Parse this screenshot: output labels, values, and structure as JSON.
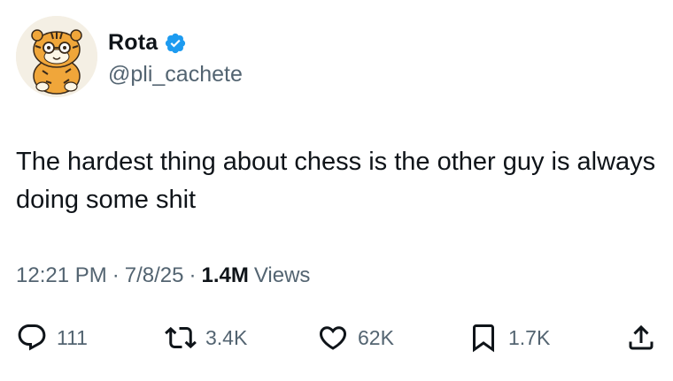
{
  "author": {
    "name": "Rota",
    "handle": "@pli_cachete",
    "verified": true,
    "avatar": "cartoon-tiger-avatar",
    "verified_icon": "verified-badge-icon",
    "verified_color": "#1d9bf0"
  },
  "tweet": {
    "text": "The hardest thing about chess is the other guy is always doing some shit"
  },
  "meta": {
    "time": "12:21 PM",
    "separator": "·",
    "date": "7/8/25",
    "views_count": "1.4M",
    "views_label": "Views"
  },
  "actions": {
    "replies": {
      "icon": "reply-icon",
      "count": "111"
    },
    "reposts": {
      "icon": "repost-icon",
      "count": "3.4K"
    },
    "likes": {
      "icon": "heart-icon",
      "count": "62K"
    },
    "bookmarks": {
      "icon": "bookmark-icon",
      "count": "1.7K"
    },
    "share": {
      "icon": "share-icon"
    }
  },
  "colors": {
    "text": "#0f1419",
    "secondary": "#536471",
    "accent": "#1d9bf0"
  }
}
